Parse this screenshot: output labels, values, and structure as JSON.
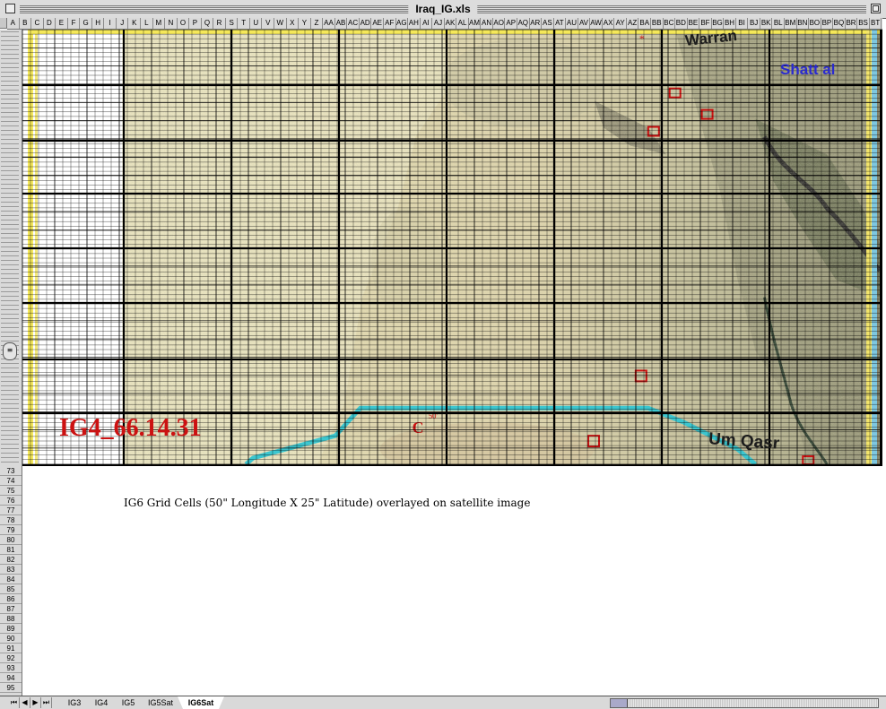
{
  "window": {
    "title": "Iraq_IG.xls"
  },
  "columns": [
    "A",
    "B",
    "C",
    "D",
    "E",
    "F",
    "G",
    "H",
    "I",
    "J",
    "K",
    "L",
    "M",
    "N",
    "O",
    "P",
    "Q",
    "R",
    "S",
    "T",
    "U",
    "V",
    "W",
    "X",
    "Y",
    "Z",
    "AA",
    "AB",
    "AC",
    "AD",
    "AE",
    "AF",
    "AG",
    "AH",
    "AI",
    "AJ",
    "AK",
    "AL",
    "AM",
    "AN",
    "AO",
    "AP",
    "AQ",
    "AR",
    "AS",
    "AT",
    "AU",
    "AV",
    "AW",
    "AX",
    "AY",
    "AZ",
    "BA",
    "BB",
    "BC",
    "BD",
    "BE",
    "BF",
    "BG",
    "BH",
    "BI",
    "BJ",
    "BK",
    "BL",
    "BM",
    "BN",
    "BO",
    "BP",
    "BQ",
    "BR",
    "BS",
    "BT"
  ],
  "lower_rows": [
    "73",
    "74",
    "75",
    "76",
    "77",
    "78",
    "79",
    "80",
    "81",
    "82",
    "83",
    "84",
    "85",
    "86",
    "87",
    "88",
    "89",
    "90",
    "91",
    "92",
    "93",
    "94",
    "95"
  ],
  "sheet": {
    "caption": "IG6 Grid Cells (50\" Longitude X 25\" Latitude) overlayed on satellite image",
    "ig4_label": "IG4_66.14.31",
    "map_labels": {
      "wafran": "Warran",
      "shatt": "Shatt al",
      "umm_qasr": "Um Qasr"
    }
  },
  "tabs": [
    "IG3",
    "IG4",
    "IG5",
    "IG5Sat",
    "IG6Sat"
  ],
  "active_tab": "IG6Sat",
  "colors": {
    "river": "#3cc6cf",
    "label_red": "#cc1111",
    "shatt_blue": "#2a2acf"
  }
}
